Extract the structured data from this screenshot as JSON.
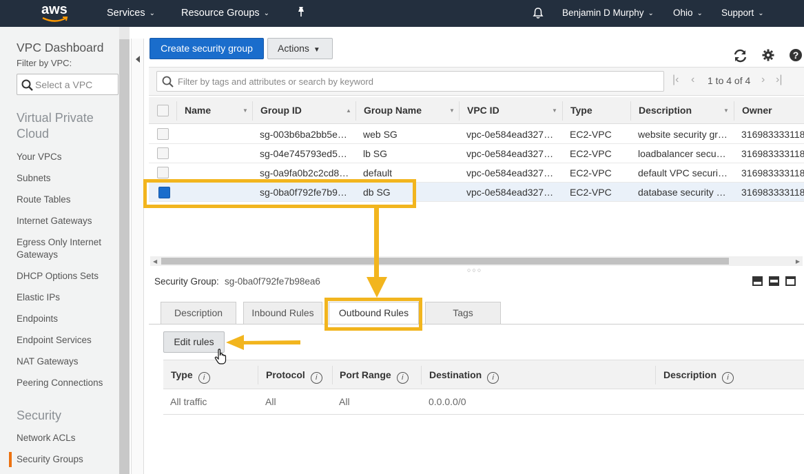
{
  "topnav": {
    "logo": "aws",
    "services": "Services",
    "resource_groups": "Resource Groups",
    "user": "Benjamin D Murphy",
    "region": "Ohio",
    "support": "Support"
  },
  "sidebar": {
    "title": "VPC Dashboard",
    "filter_label": "Filter by VPC:",
    "vpc_placeholder": "Select a VPC",
    "section_vpc": "Virtual Private Cloud",
    "vpc_items": [
      "Your VPCs",
      "Subnets",
      "Route Tables",
      "Internet Gateways",
      "Egress Only Internet Gateways",
      "DHCP Options Sets",
      "Elastic IPs",
      "Endpoints",
      "Endpoint Services",
      "NAT Gateways",
      "Peering Connections"
    ],
    "section_security": "Security",
    "security_items": [
      "Network ACLs",
      "Security Groups"
    ]
  },
  "toolbar": {
    "create_label": "Create security group",
    "actions_label": "Actions"
  },
  "filter": {
    "placeholder": "Filter by tags and attributes or search by keyword",
    "pagination": "1 to 4 of 4"
  },
  "table": {
    "columns": [
      "Name",
      "Group ID",
      "Group Name",
      "VPC ID",
      "Type",
      "Description",
      "Owner"
    ],
    "rows": [
      {
        "name": "",
        "group_id": "sg-003b6ba2bb5e…",
        "group_name": "web SG",
        "vpc_id": "vpc-0e584ead327…",
        "type": "EC2-VPC",
        "description": "website security gr…",
        "owner": "316983333118"
      },
      {
        "name": "",
        "group_id": "sg-04e745793ed5…",
        "group_name": "lb SG",
        "vpc_id": "vpc-0e584ead327…",
        "type": "EC2-VPC",
        "description": "loadbalancer secu…",
        "owner": "316983333118"
      },
      {
        "name": "",
        "group_id": "sg-0a9fa0b2c2cd8…",
        "group_name": "default",
        "vpc_id": "vpc-0e584ead327…",
        "type": "EC2-VPC",
        "description": "default VPC securi…",
        "owner": "316983333118"
      },
      {
        "name": "",
        "group_id": "sg-0ba0f792fe7b9…",
        "group_name": "db SG",
        "vpc_id": "vpc-0e584ead327…",
        "type": "EC2-VPC",
        "description": "database security …",
        "owner": "316983333118",
        "selected": true
      }
    ]
  },
  "details": {
    "label": "Security Group:",
    "value": "sg-0ba0f792fe7b98ea6",
    "tabs": [
      "Description",
      "Inbound Rules",
      "Outbound Rules",
      "Tags"
    ],
    "active_tab": "Outbound Rules",
    "edit_label": "Edit rules",
    "rule_columns": [
      "Type",
      "Protocol",
      "Port Range",
      "Destination",
      "Description"
    ],
    "rules": [
      {
        "type": "All traffic",
        "protocol": "All",
        "port_range": "All",
        "destination": "0.0.0.0/0",
        "description": ""
      }
    ]
  },
  "colors": {
    "nav_bg": "#232f3e",
    "primary_blue": "#1a6dcc",
    "highlight_yellow": "#f2b51e",
    "active_orange": "#ec7211"
  }
}
